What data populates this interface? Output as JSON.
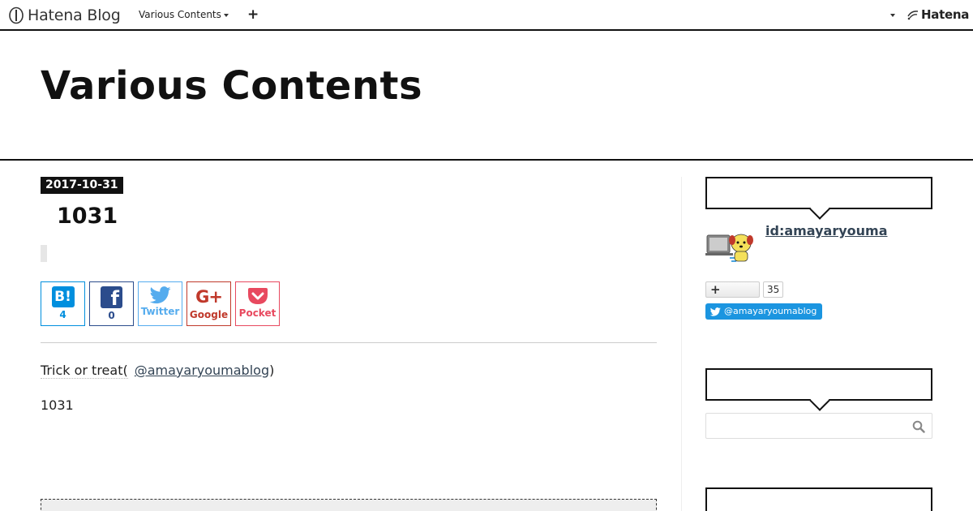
{
  "topbar": {
    "logo_text": "Hatena Blog",
    "blog_menu_label": "Various Contents",
    "add_label": "+",
    "hatena_label": "Hatena"
  },
  "header": {
    "blog_title": "Various Contents"
  },
  "entry": {
    "date": "2017-10-31",
    "title": "1031",
    "share": {
      "hatena_mark": "B!",
      "hatena_count": "4",
      "facebook_mark": "f",
      "facebook_count": "0",
      "twitter_label": "Twitter",
      "google_mark": "G+",
      "google_label": "Google",
      "pocket_label": "Pocket"
    },
    "body_text": "Trick or treat(",
    "mention": "@amayaryoumablog",
    "body_close": ")",
    "body_line2": "1031"
  },
  "sidebar": {
    "profile_id": "id:amayaryouma",
    "follow_label": "+",
    "follow_count": "35",
    "twitter_follow_label": "@amayaryoumablog",
    "search_placeholder": ""
  },
  "colors": {
    "hatena_blue": "#008fde",
    "facebook": "#2b4c8c",
    "twitter": "#55acee",
    "google": "#c0392b",
    "pocket": "#e8495f",
    "link": "#334455"
  }
}
